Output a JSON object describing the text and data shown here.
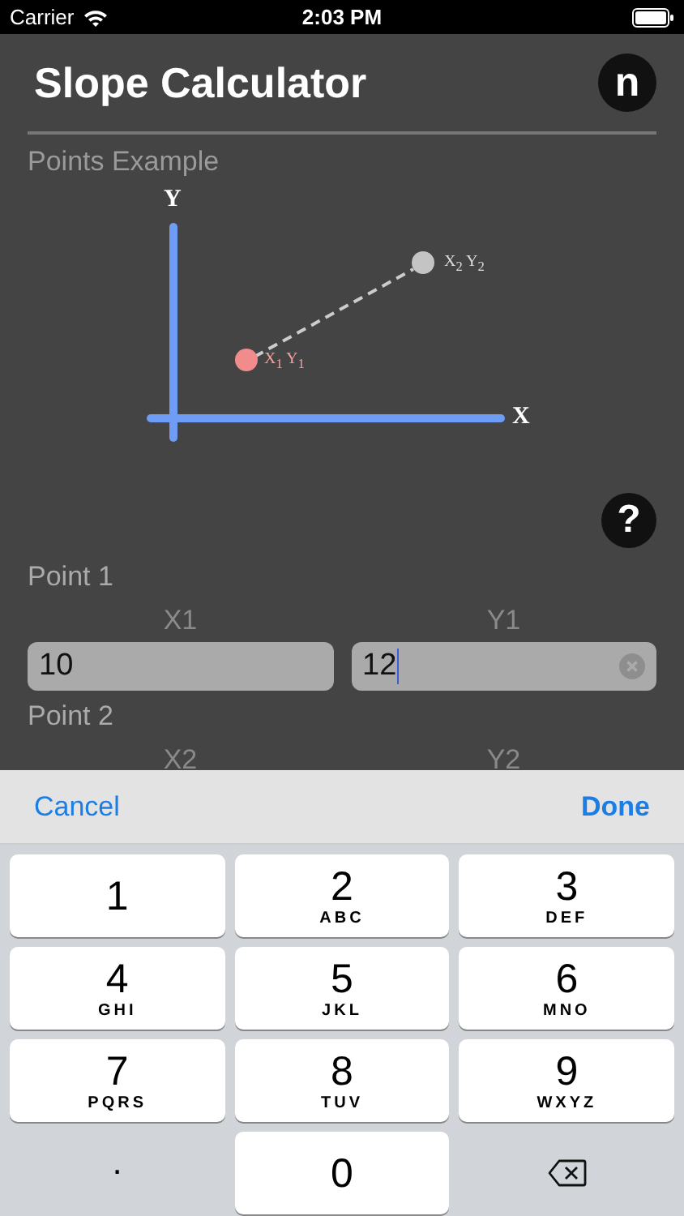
{
  "status_bar": {
    "carrier": "Carrier",
    "time": "2:03 PM"
  },
  "header": {
    "title": "Slope Calculator",
    "logo": "n"
  },
  "example": {
    "title": "Points Example",
    "y_axis": "Y",
    "x_axis": "X",
    "point1_label": "X$_{1}$ Y$_{1}$",
    "point2_label": "X$_{2}$ Y$_{2}$"
  },
  "help": "?",
  "points": [
    {
      "title": "Point 1",
      "fields": [
        {
          "label": "X1",
          "value": "10",
          "focused": false
        },
        {
          "label": "Y1",
          "value": "12",
          "focused": true
        }
      ]
    },
    {
      "title": "Point 2",
      "fields": [
        {
          "label": "X2"
        },
        {
          "label": "Y2"
        }
      ]
    }
  ],
  "toolbar": {
    "cancel": "Cancel",
    "done": "Done"
  },
  "key_rows": [
    [
      {
        "kind": "digit",
        "digit": "1"
      },
      {
        "kind": "digit",
        "digit": "2",
        "letters": "ABC"
      },
      {
        "kind": "digit",
        "digit": "3",
        "letters": "DEF"
      }
    ],
    [
      {
        "kind": "digit",
        "digit": "4",
        "letters": "GHI"
      },
      {
        "kind": "digit",
        "digit": "5",
        "letters": "JKL"
      },
      {
        "kind": "digit",
        "digit": "6",
        "letters": "MNO"
      }
    ],
    [
      {
        "kind": "digit",
        "digit": "7",
        "letters": "PQRS"
      },
      {
        "kind": "digit",
        "digit": "8",
        "letters": "TUV"
      },
      {
        "kind": "digit",
        "digit": "9",
        "letters": "WXYZ"
      }
    ],
    [
      {
        "kind": "plain",
        "digit": "."
      },
      {
        "kind": "digit",
        "digit": "0"
      },
      {
        "kind": "delete"
      }
    ]
  ]
}
